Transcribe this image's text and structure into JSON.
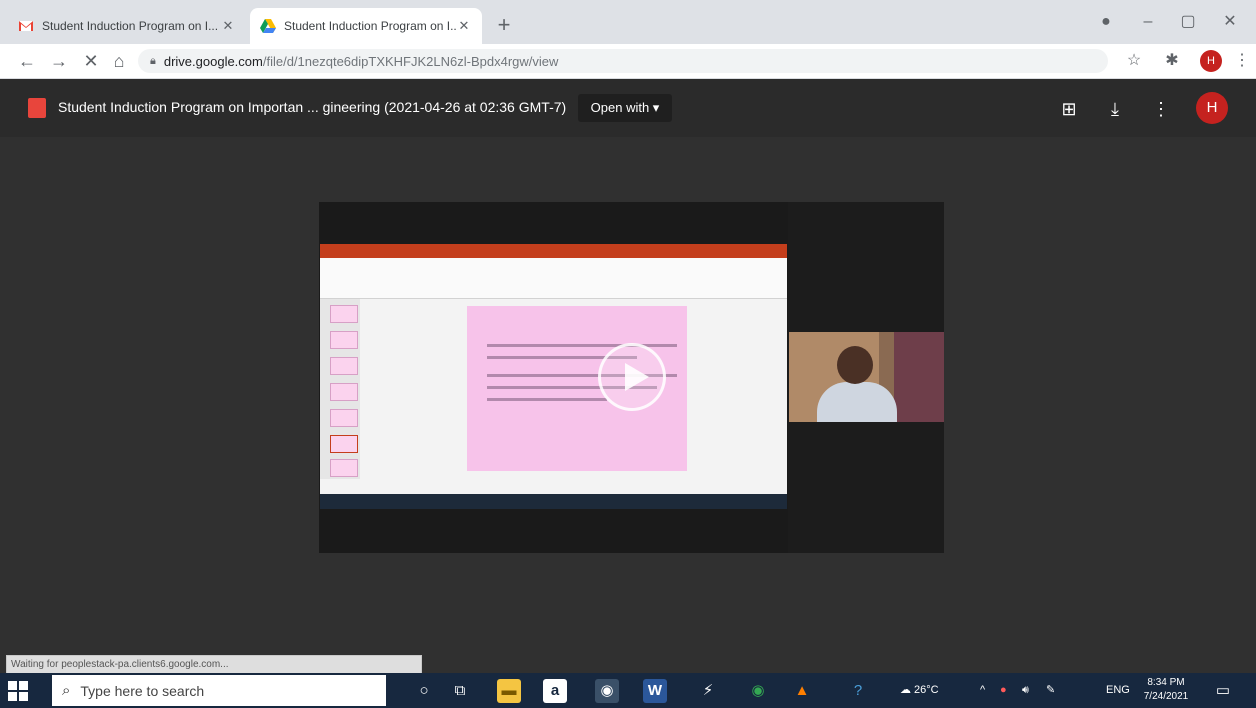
{
  "browser": {
    "tabs": [
      {
        "title": "Student Induction Program on I...",
        "favicon": "gmail-icon",
        "close": "✕"
      },
      {
        "title": "Student Induction Program on I...",
        "favicon": "google-drive-icon",
        "close": "✕"
      }
    ],
    "new_tab": "+",
    "address": {
      "host": "drive.google.com",
      "path": "/file/d/1nezqte6dipTXKHFJK2LN6zl-Bpdx4rgw/view"
    },
    "profile_initial": "H",
    "window_controls": {
      "minimize": "–",
      "maximize": "▢",
      "close": "✕"
    }
  },
  "viewer": {
    "file_title": "Student Induction Program on Importan ... gineering (2021-04-26 at 02:36 GMT-7)",
    "open_with": "Open with ▾",
    "profile_initial": "H",
    "status_text": "Waiting for peoplestack-pa.clients6.google.com..."
  },
  "taskbar": {
    "search_placeholder": "Type here to search",
    "weather": "26°C",
    "language": "ENG",
    "time": "8:34 PM",
    "date": "7/24/2021"
  },
  "colors": {
    "tabstrip": "#dee1e6",
    "viewer_bg": "#303030",
    "taskbar": "#17283f",
    "accent_red": "#c5221f",
    "slide_pink": "#f7c3ea"
  }
}
